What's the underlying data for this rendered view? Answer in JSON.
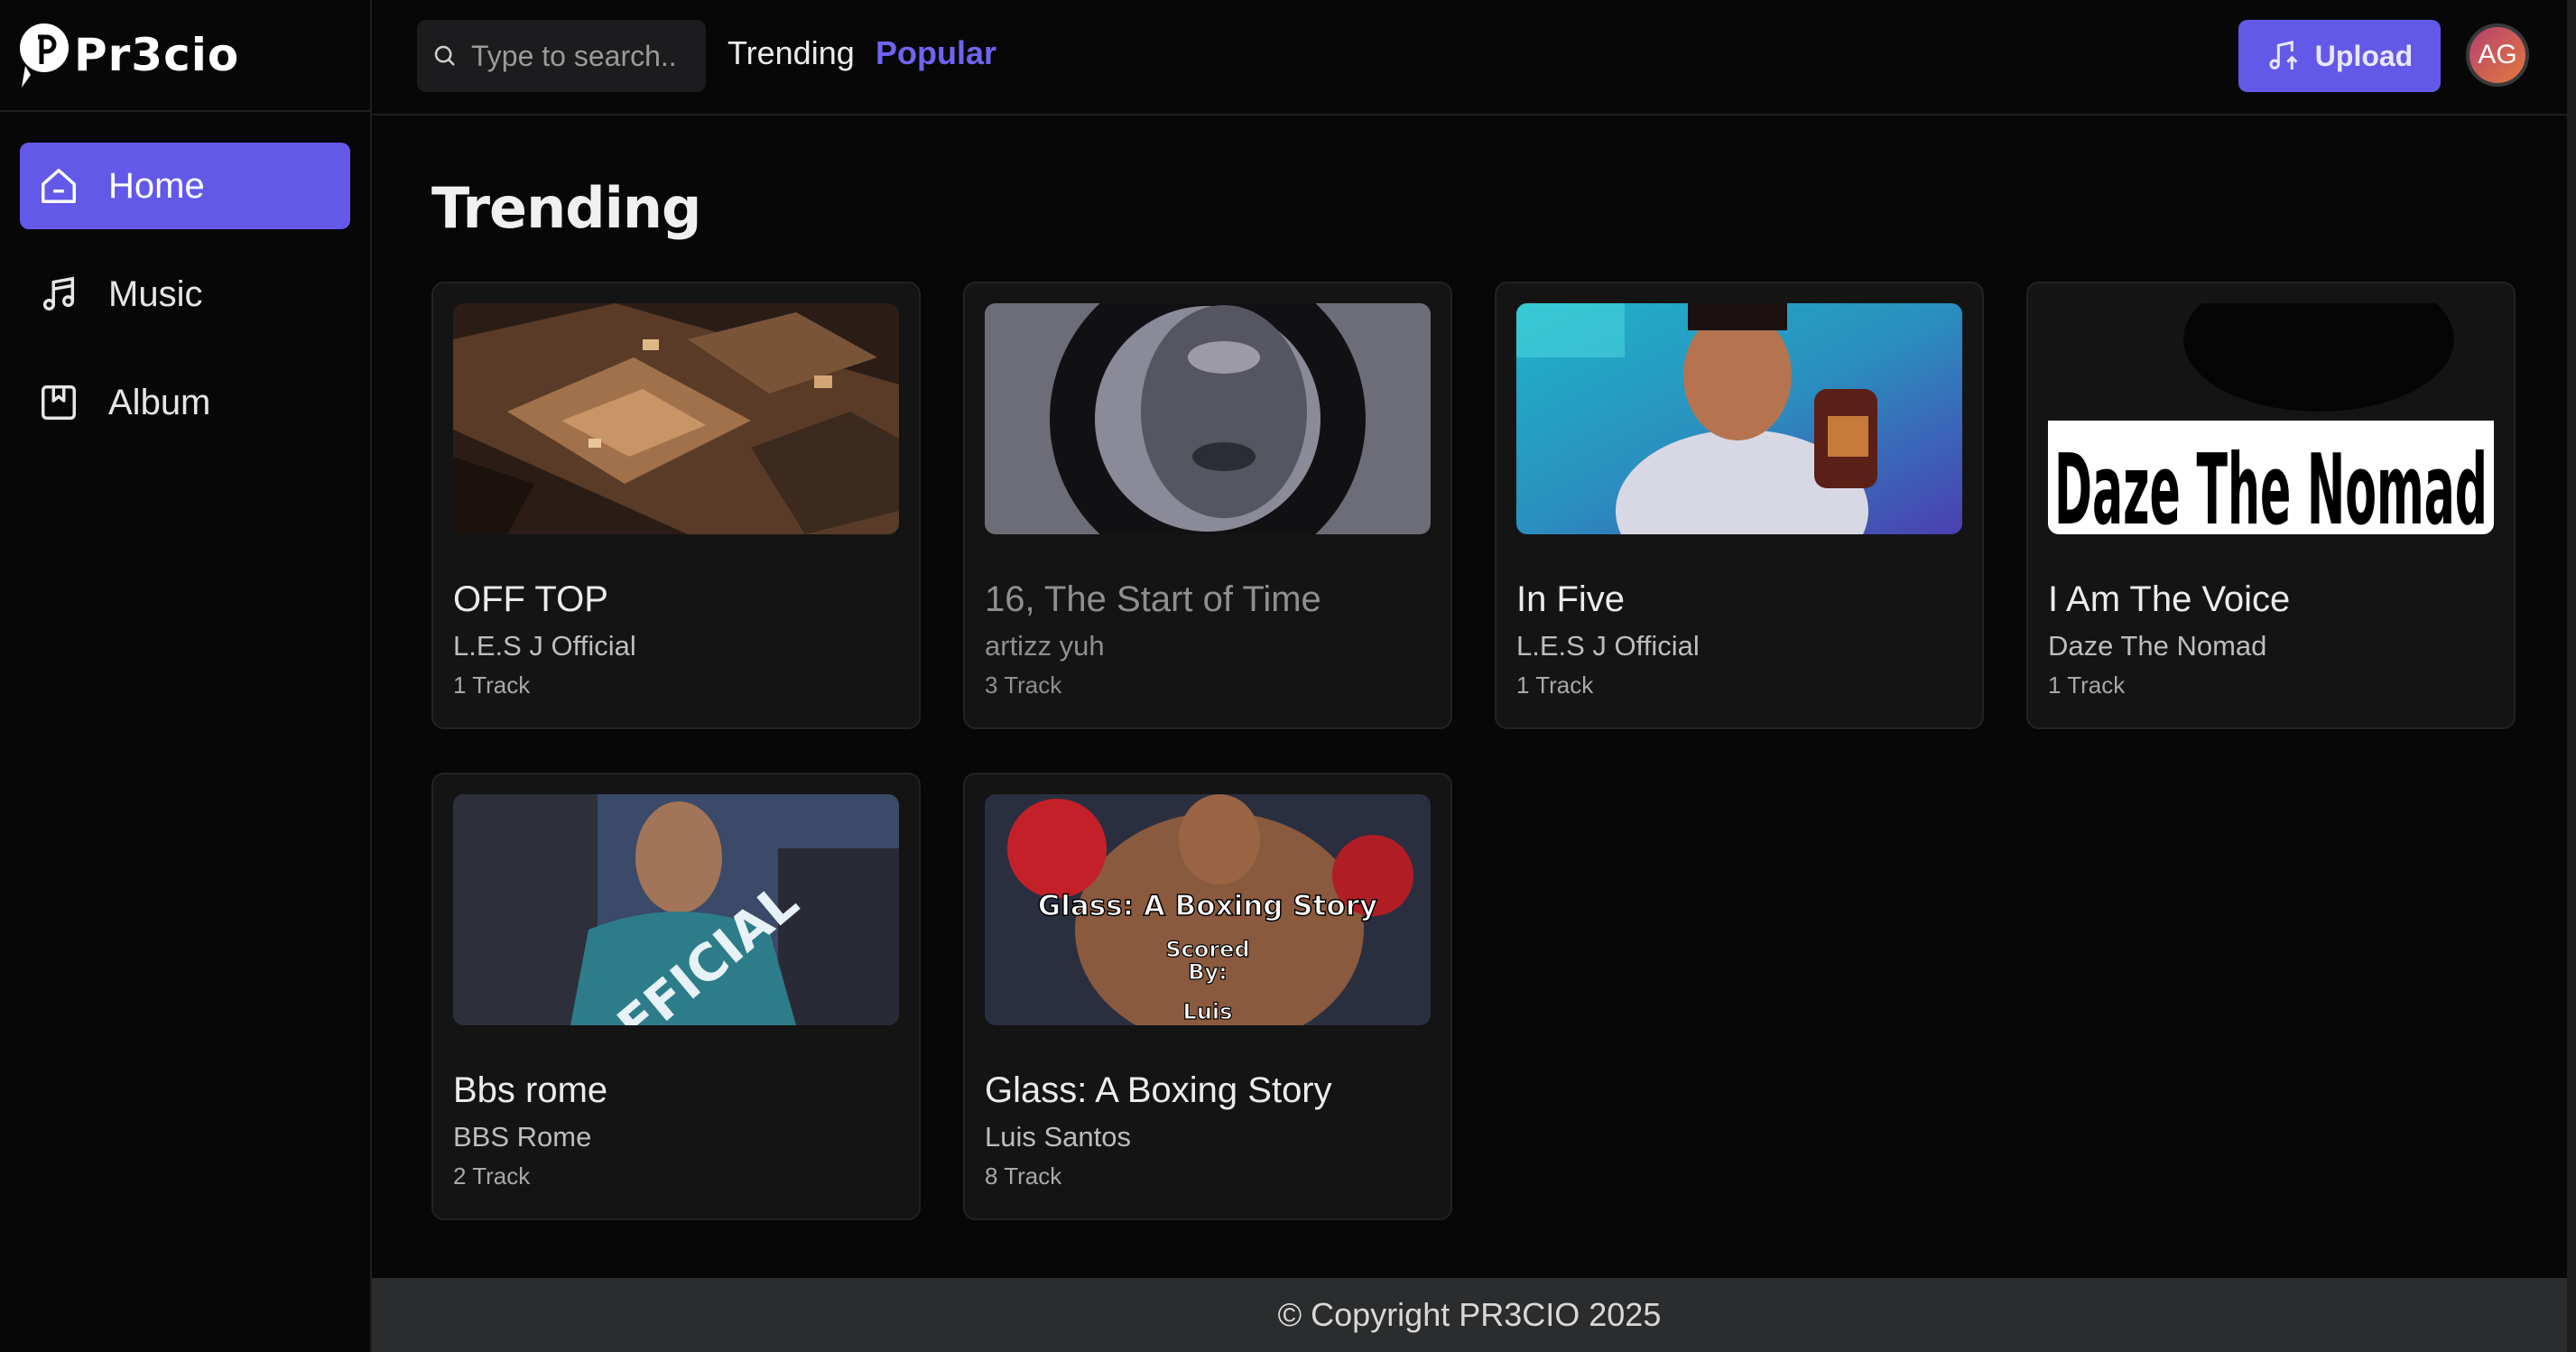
{
  "app": {
    "name": "Pr3cio"
  },
  "sidebar": {
    "items": [
      {
        "label": "Home",
        "icon": "home-icon",
        "active": true
      },
      {
        "label": "Music",
        "icon": "music-note-icon",
        "active": false
      },
      {
        "label": "Album",
        "icon": "album-icon",
        "active": false
      }
    ]
  },
  "header": {
    "search_placeholder": "Type to search..",
    "tabs": [
      {
        "label": "Trending"
      },
      {
        "label": "Popular",
        "active": true
      }
    ],
    "upload_label": "Upload",
    "avatar_initials": "AG"
  },
  "main": {
    "title": "Trending",
    "albums": [
      {
        "title": "OFF TOP",
        "artist": "L.E.S J Official",
        "tracks": "1 Track"
      },
      {
        "title": "16, The Start of Time",
        "artist": "artizz yuh",
        "tracks": "3 Track"
      },
      {
        "title": "In Five",
        "artist": "L.E.S J Official",
        "tracks": "1 Track"
      },
      {
        "title": "I Am The Voice",
        "artist": "Daze The Nomad",
        "tracks": "1 Track",
        "cover_text": "Daze The Nomad"
      },
      {
        "title": "Bbs rome",
        "artist": "BBS Rome",
        "tracks": "2 Track",
        "cover_text": "OFFICIAL"
      },
      {
        "title": "Glass: A Boxing Story",
        "artist": "Luis Santos",
        "tracks": "8 Track",
        "cover_text": [
          "Glass: A Boxing Story",
          "Scored",
          "By:",
          "Luis"
        ]
      }
    ]
  },
  "footer": {
    "copyright": "© Copyright PR3CIO 2025"
  },
  "colors": {
    "accent": "#6359e9",
    "background": "#070707",
    "card": "#141414",
    "footer": "#2a2c2d"
  }
}
